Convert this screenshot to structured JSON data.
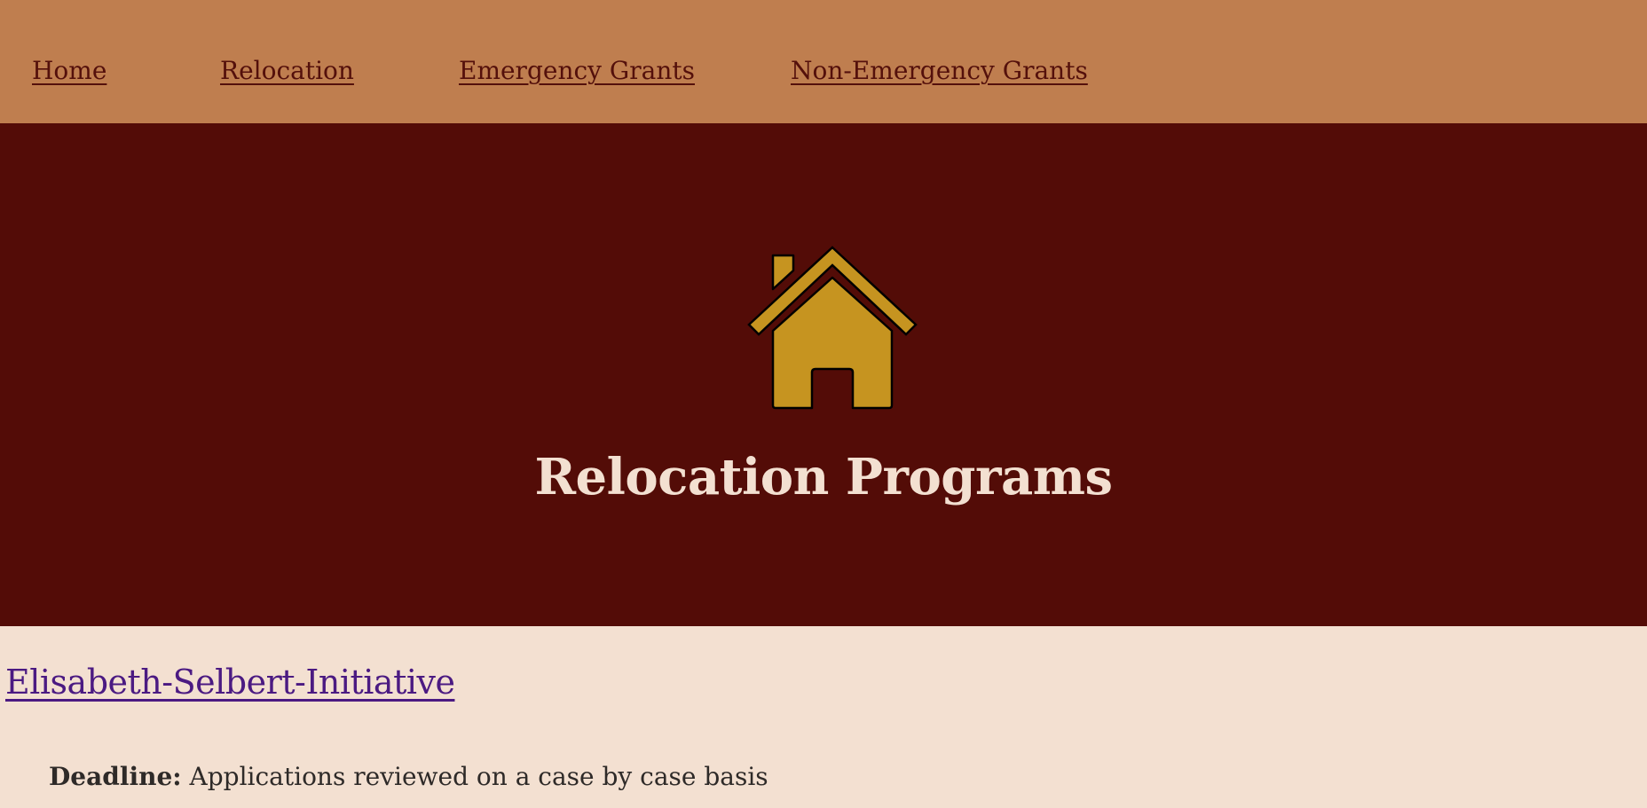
{
  "nav": {
    "items": [
      {
        "label": "Home"
      },
      {
        "label": "Relocation"
      },
      {
        "label": "Emergency Grants"
      },
      {
        "label": "Non-Emergency Grants"
      }
    ]
  },
  "hero": {
    "icon": "house-icon",
    "title": "Relocation Programs"
  },
  "program": {
    "title": "Elisabeth-Selbert-Initiative",
    "deadline_label": "Deadline:",
    "deadline_value": "Applications reviewed on a case by case basis"
  },
  "colors": {
    "nav_background": "#bf7e4f",
    "hero_background": "#530c07",
    "page_background": "#f3e0d1",
    "icon_fill": "#c69420",
    "link_color": "#4b1a82"
  }
}
